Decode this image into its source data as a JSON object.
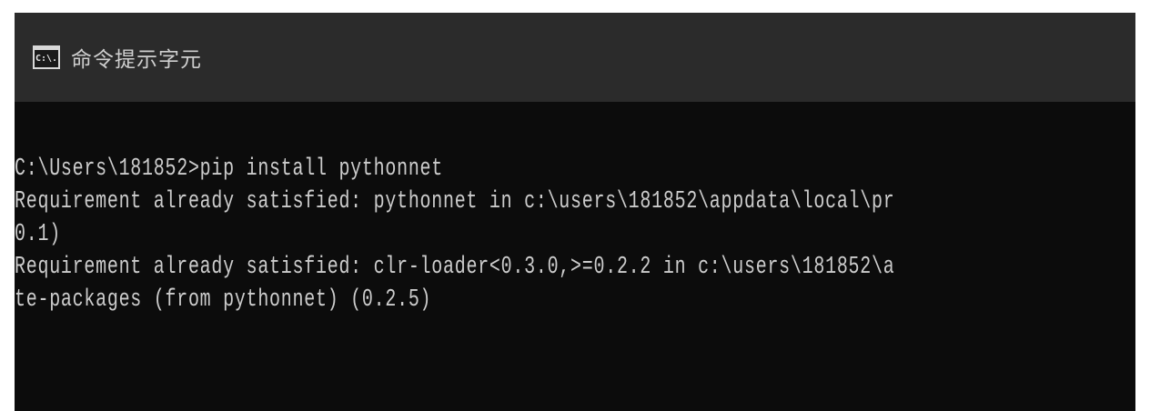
{
  "window": {
    "title": "命令提示字元",
    "icon_label": "C:\\.",
    "icon": "cmd-icon"
  },
  "console": {
    "lines": [
      "C:\\Users\\181852>pip install pythonnet",
      "Requirement already satisfied: pythonnet in c:\\users\\181852\\appdata\\local\\pr",
      "0.1)",
      "Requirement already satisfied: clr-loader<0.3.0,>=0.2.2 in c:\\users\\181852\\a",
      "te-packages (from pythonnet) (0.2.5)"
    ]
  }
}
